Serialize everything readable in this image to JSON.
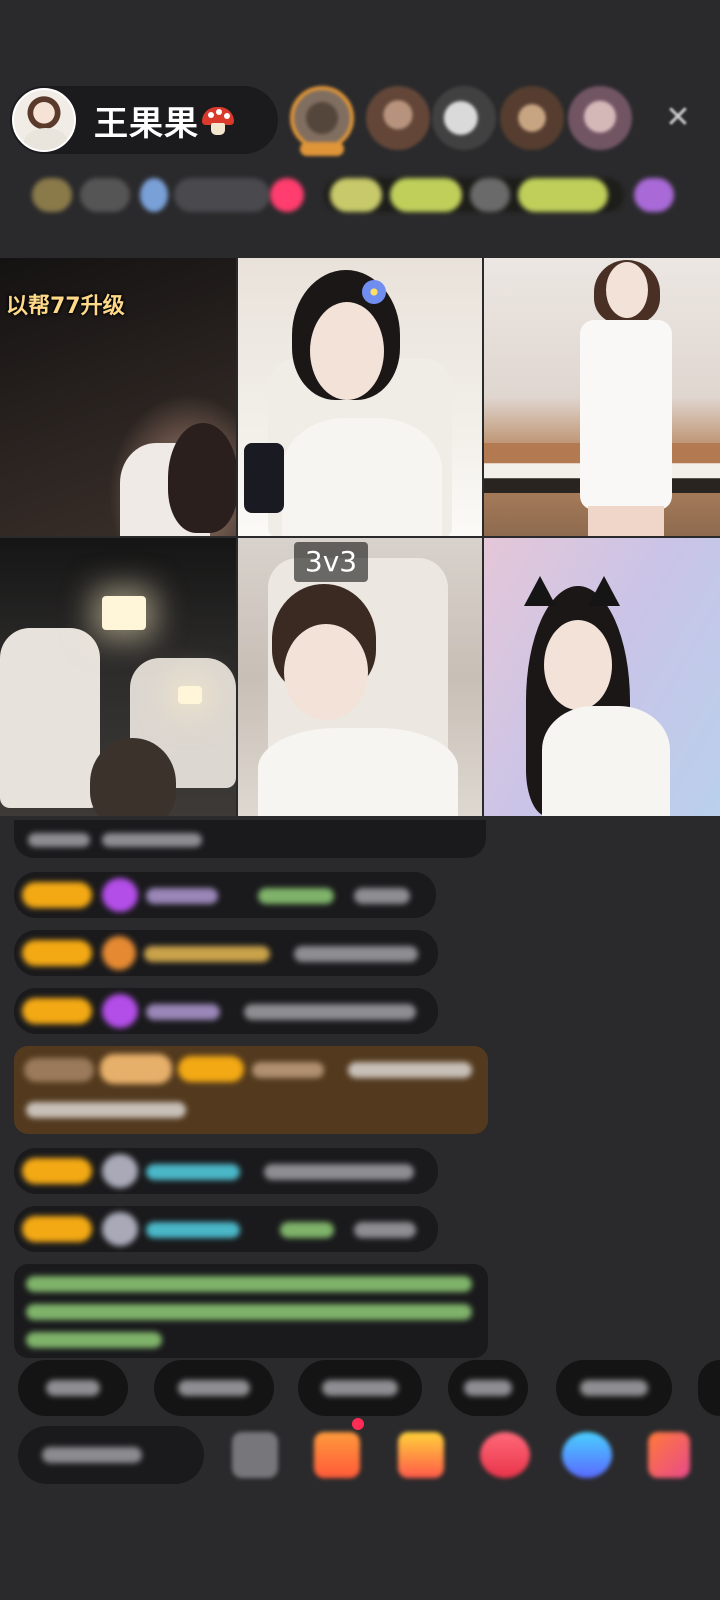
{
  "header": {
    "host_name": "王果果",
    "host_badge_icon": "mushroom-icon",
    "close_icon": "close-icon",
    "viewer_count": 5
  },
  "video_grid": {
    "tile_1_caption": "以帮77升级",
    "pk_label": "3v3"
  },
  "bottom_bar": {
    "icons": [
      "emoji-icon",
      "gift-box-icon",
      "gift-icon",
      "pk-icon",
      "chat-bubble-icon",
      "more-grid-icon"
    ]
  },
  "colors": {
    "background": "#2a2a2c",
    "level_badge": "#f3a914",
    "gem_badge": "#b34ee8",
    "gift_row": "#62401a"
  }
}
